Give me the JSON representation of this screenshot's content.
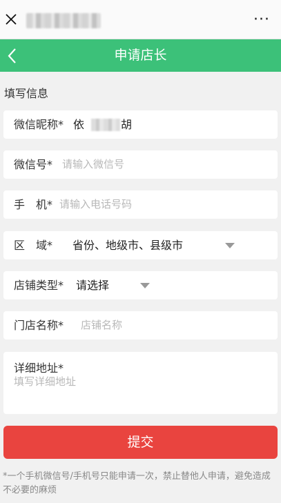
{
  "topbar": {
    "close_icon": "close-icon",
    "more_icon": "more-icon",
    "more_label": "···"
  },
  "header": {
    "title": "申请店长",
    "back_icon": "chevron-left-icon",
    "color": "#3cc179"
  },
  "section": {
    "title": "填写信息"
  },
  "form": {
    "wechat_nick": {
      "label": "微信昵称*",
      "value_start": "依",
      "value_end": "胡"
    },
    "wechat_id": {
      "label": "微信号*",
      "placeholder": "请输入微信号"
    },
    "phone": {
      "label": "手　机*",
      "placeholder": "请输入电话号码"
    },
    "region": {
      "label": "区　域*",
      "value": "省份、地级市、县级市"
    },
    "shop_type": {
      "label": "店铺类型*",
      "value": "请选择"
    },
    "shop_name": {
      "label": "门店名称*",
      "placeholder": "店铺名称"
    },
    "address": {
      "label": "详细地址*",
      "placeholder": "填写详细地址"
    }
  },
  "submit": {
    "label": "提交",
    "color": "#e9443f"
  },
  "footnote": "*一个手机微信号/手机号只能申请一次，禁止替他人申请，避免造成不必要的麻烦"
}
